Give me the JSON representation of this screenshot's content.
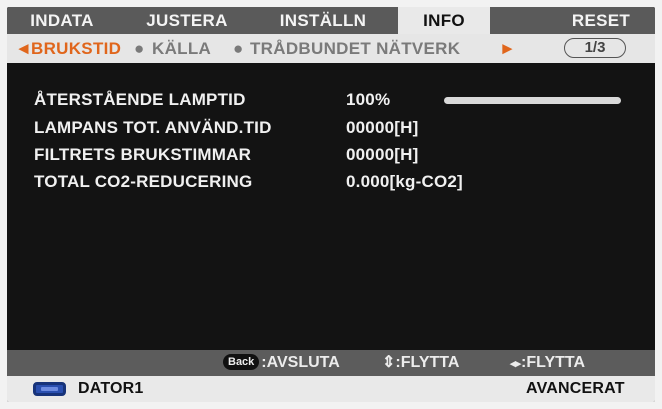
{
  "tabs": [
    {
      "label": "INDATA",
      "active": false
    },
    {
      "label": "JUSTERA",
      "active": false
    },
    {
      "label": "INSTÄLLN",
      "active": false
    },
    {
      "label": "INFO",
      "active": true
    },
    {
      "label": "RESET",
      "active": false
    }
  ],
  "subnav": {
    "left_arrow": "◄",
    "active": "BRUKSTID",
    "items": [
      "KÄLLA",
      "TRÅDBUNDET NÄTVERK"
    ],
    "separator": "●",
    "right_arrow": "►",
    "page": "1/3"
  },
  "info": [
    {
      "label": "ÅTERSTÅENDE LAMPTID",
      "value": "100%"
    },
    {
      "label": "LAMPANS TOT. ANVÄND.TID",
      "value": "00000[H]"
    },
    {
      "label": "FILTRETS BRUKSTIMMAR",
      "value": "00000[H]"
    },
    {
      "label": "TOTAL CO2-REDUCERING",
      "value": "0.000[kg-CO2]"
    }
  ],
  "lamp_level_percent": 100,
  "help": {
    "back_key": "Back",
    "exit": ":AVSLUTA",
    "move_vertical_icon": "⇕",
    "move_vertical": ":FLYTTA",
    "move_horizontal_icon": "◂▸",
    "move_horizontal": ":FLYTTA"
  },
  "status": {
    "source_icon": "monitor-icon",
    "source": "DATOR1",
    "mode": "AVANCERAT"
  },
  "colors": {
    "accent": "#e0661c",
    "menu_bg": "#131313",
    "source_icon": "#2a4fb0"
  }
}
